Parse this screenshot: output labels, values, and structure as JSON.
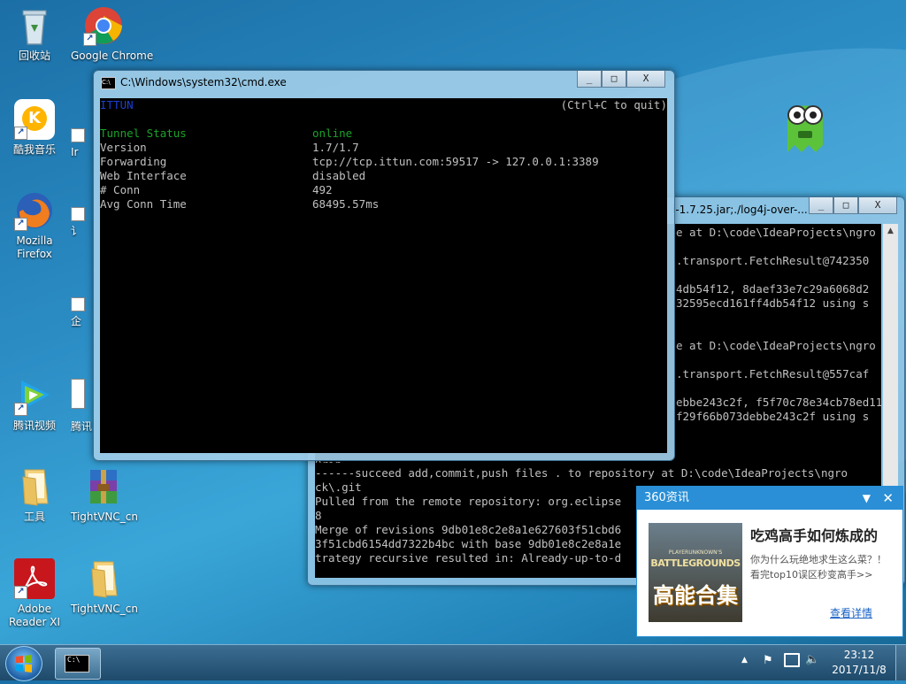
{
  "desktop": {
    "icons": [
      {
        "label": "回收站",
        "icon": "recycle-bin-icon"
      },
      {
        "label": "Google Chrome",
        "icon": "chrome-icon"
      },
      {
        "label": "酷我音乐",
        "icon": "kuwo-music-icon"
      },
      {
        "label": "Mozilla Firefox",
        "icon": "firefox-icon"
      },
      {
        "label": "腾讯视频",
        "icon": "tencent-video-icon"
      },
      {
        "label": "工具",
        "icon": "folder-icon"
      },
      {
        "label": "TightVNC_cn",
        "icon": "winrar-archive-icon"
      },
      {
        "label": "Adobe Reader XI",
        "icon": "adobe-reader-icon"
      },
      {
        "label": "TightVNC_cn",
        "icon": "folder-icon"
      }
    ],
    "partial_labels": [
      "Ir",
      "讠",
      "企",
      "腾讯"
    ]
  },
  "cmd_window": {
    "title": "C:\\Windows\\system32\\cmd.exe",
    "header_left": "ITTUN",
    "header_right": "(Ctrl+C to quit)",
    "rows": [
      {
        "key": "Tunnel Status",
        "value": "online"
      },
      {
        "key": "Version",
        "value": "1.7/1.7"
      },
      {
        "key": "Forwarding",
        "value": "tcp://tcp.ittun.com:59517 -> 127.0.0.1:3389"
      },
      {
        "key": "Web Interface",
        "value": "disabled"
      },
      {
        "key": "# Conn",
        "value": "492"
      },
      {
        "key": "Avg Conn Time",
        "value": "68495.57ms"
      }
    ],
    "colors": {
      "header_left": "#1c3fd0",
      "status": "#1aa32a"
    }
  },
  "back_window": {
    "title": "i-1.7.25.jar;./log4j-over-...",
    "lines_top": [
      "e at D:\\code\\IdeaProjects\\ngro",
      "",
      ".transport.FetchResult@742350",
      "",
      "4db54f12, 8daef33e7c29a6068d2",
      "32595ecd161ff4db54f12 using s",
      "",
      "",
      "e at D:\\code\\IdeaProjects\\ngro",
      "",
      ".transport.FetchResult@557caf",
      "",
      "ebbe243c2f, f5f70c78e34cb78ed11",
      "f29f66b073debbe243c2f using s"
    ],
    "lines_bottom": [
      "------succeed add,commit,push files . to repository at D:\\code\\IdeaProjects\\ngro",
      "ck\\.git",
      "Pulled from the remote repository: org.eclipse",
      "8",
      "Merge of revisions 9db01e8c2e8a1e627603f51cbd6",
      "3f51cbd6154dd7322b4bc with base 9db01e8c2e8a1e",
      "trategy recursive resulted in: Already-up-to-d"
    ],
    "partial_top": "9rin"
  },
  "notification": {
    "app": "360资讯",
    "headline": "吃鸡高手如何炼成的",
    "body": "你为什么玩绝地求生这么菜？！看完top10误区秒变高手>>",
    "link": "查看详情",
    "image_brand": "PLAYERUNKNOWN'S",
    "image_title": "BATTLEGROUNDS",
    "image_caption": "高能合集"
  },
  "taskbar": {
    "time": "23:12",
    "date": "2017/11/8",
    "cmd_task_label": "C:\\"
  }
}
